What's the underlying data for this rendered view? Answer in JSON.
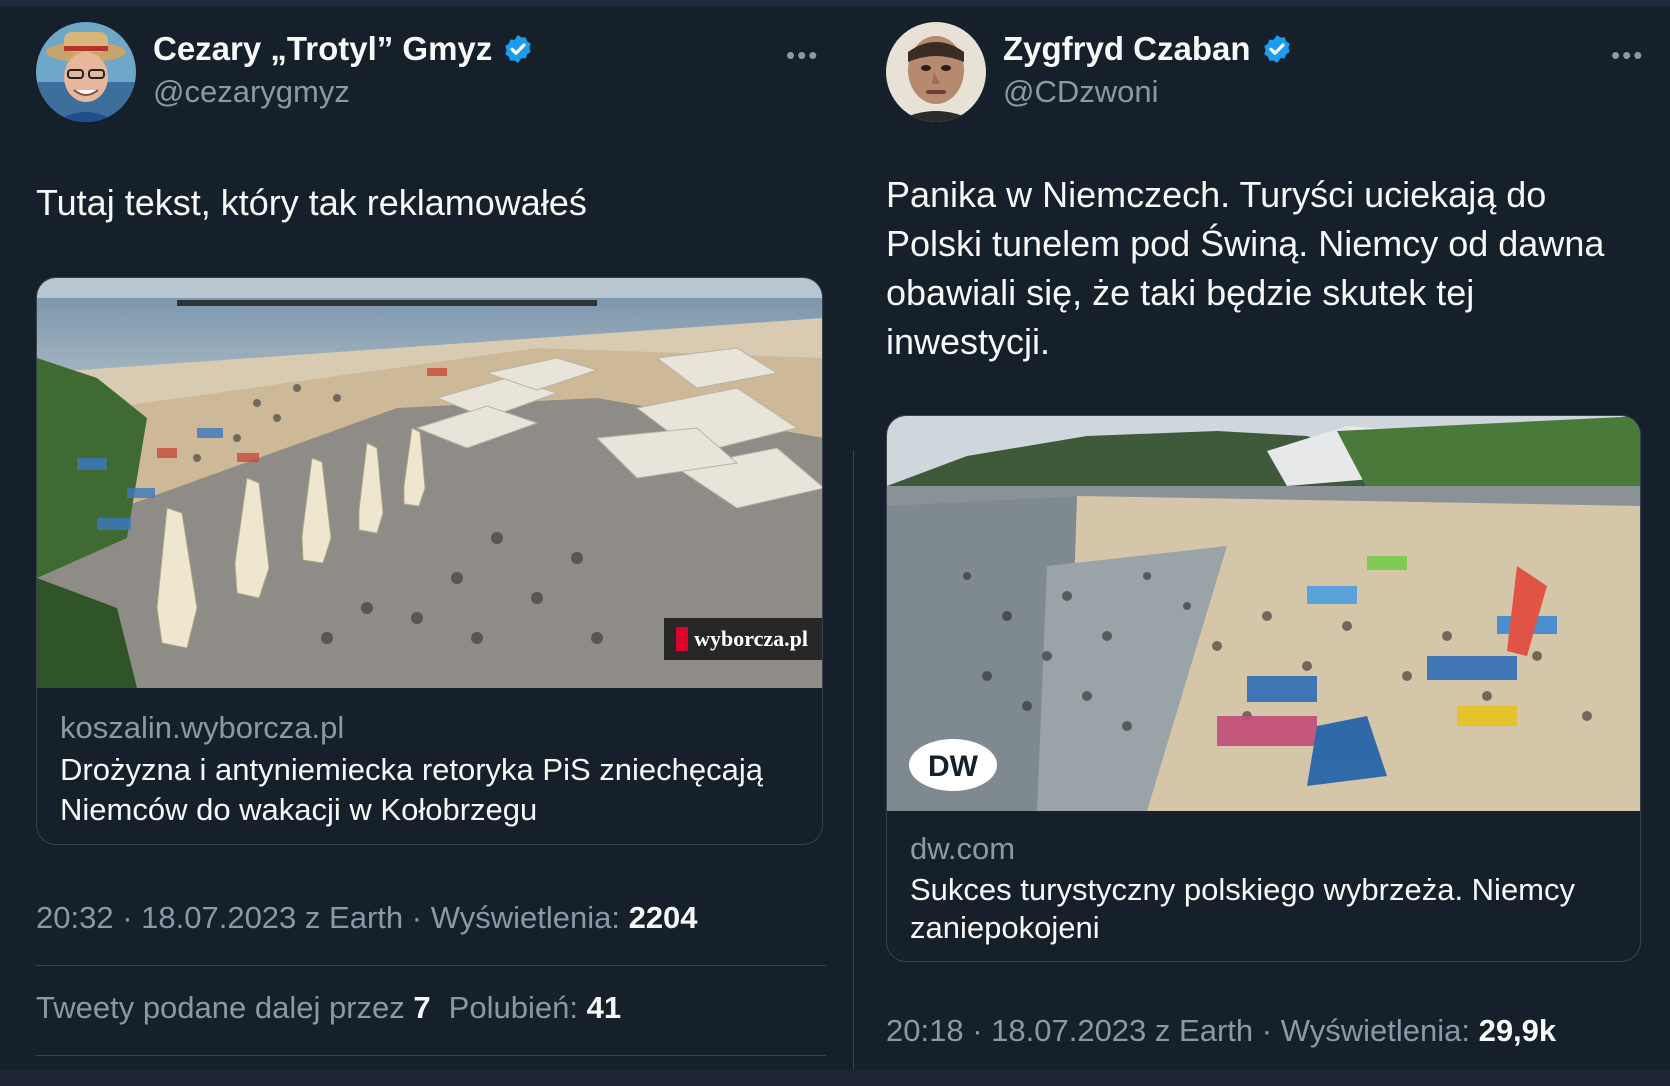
{
  "left_tweet": {
    "author": "Cezary „Trotyl” Gmyz",
    "handle": "@cezarygmyz",
    "more_label": "•••",
    "text": "Tutaj tekst, który tak reklamowałeś",
    "card": {
      "domain": "koszalin.wyborcza.pl",
      "title": "Drożyzna i antyniemiecka retoryka PiS zniechęcają Niemców do wakacji w Kołobrzegu",
      "image_badge": "wyborcza.pl"
    },
    "time": "20:32",
    "date": "18.07.2023",
    "source_prefix": "z",
    "source": "Earth",
    "views_label": "Wyświetlenia:",
    "views": "2204",
    "retweets_label": "Tweety podane dalej przez",
    "retweets": "7",
    "likes_label": "Polubień:",
    "likes": "41"
  },
  "right_tweet": {
    "author": "Zygfryd Czaban",
    "handle": "@CDzwoni",
    "more_label": "•••",
    "text": "Panika w Niemczech. Turyści uciekają do Polski tunelem pod Świną. Niemcy od dawna obawiali się, że taki będzie skutek tej inwestycji.",
    "card": {
      "domain": "dw.com",
      "title": "Sukces turystyczny polskiego wybrzeża. Niemcy zaniepokojeni",
      "image_badge": "DW"
    },
    "time": "20:18",
    "date": "18.07.2023",
    "source_prefix": "z",
    "source": "Earth",
    "views_label": "Wyświetlenia:",
    "views": "29,9k"
  },
  "colors": {
    "background": "#15202b",
    "text": "#f7f9f9",
    "secondary": "#8b98a5",
    "border": "#38444d",
    "verified": "#1d9bf0"
  }
}
